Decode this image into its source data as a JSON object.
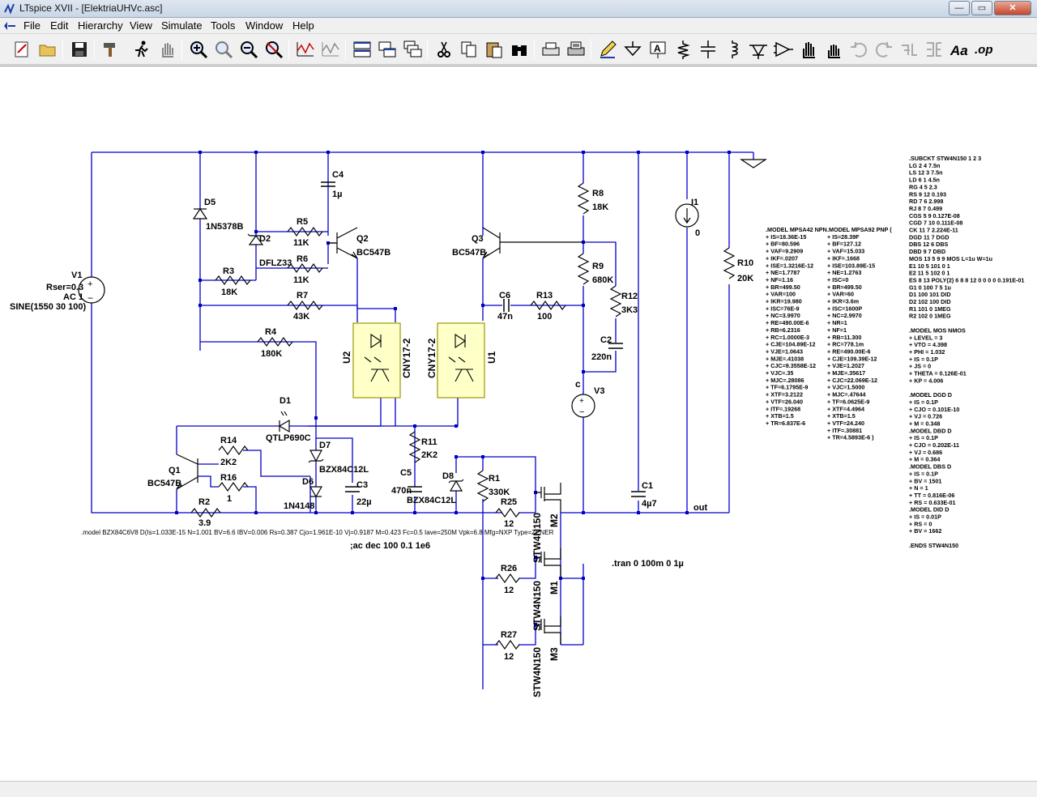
{
  "window": {
    "title": "LTspice XVII - [ElektriaUHVc.asc]",
    "controls": [
      "—",
      "▭",
      "✕"
    ],
    "mdi_controls": [
      "_",
      "❐",
      "✕"
    ]
  },
  "menu": {
    "items": [
      "File",
      "Edit",
      "Hierarchy",
      "View",
      "Simulate",
      "Tools",
      "Window",
      "Help"
    ]
  },
  "toolbar": {
    "buttons": [
      {
        "name": "new-schematic",
        "icon": "new-schematic-icon"
      },
      {
        "name": "open",
        "icon": "folder-open-icon"
      },
      {
        "name": "save",
        "icon": "floppy-icon"
      },
      {
        "name": "control-panel",
        "icon": "hammer-icon"
      },
      {
        "name": "run",
        "icon": "running-man-icon"
      },
      {
        "name": "halt",
        "icon": "hand-icon"
      },
      {
        "name": "zoom-in",
        "icon": "zoom-in-icon"
      },
      {
        "name": "pan",
        "icon": "magnifier-icon"
      },
      {
        "name": "zoom-out",
        "icon": "zoom-out-icon"
      },
      {
        "name": "zoom-fit",
        "icon": "zoom-fit-icon"
      },
      {
        "name": "autorange",
        "icon": "waveform-icon"
      },
      {
        "name": "pick-visible",
        "icon": "waveform-pick-icon"
      },
      {
        "name": "tile-horizontal",
        "icon": "tile-horizontal-icon"
      },
      {
        "name": "tile-vertical",
        "icon": "tile-vertical-icon"
      },
      {
        "name": "cascade",
        "icon": "cascade-icon"
      },
      {
        "name": "cut",
        "icon": "scissors-icon"
      },
      {
        "name": "copy",
        "icon": "copy-icon"
      },
      {
        "name": "paste",
        "icon": "paste-icon"
      },
      {
        "name": "find",
        "icon": "binoculars-icon"
      },
      {
        "name": "print-setup",
        "icon": "print-setup-icon"
      },
      {
        "name": "print",
        "icon": "printer-icon"
      },
      {
        "name": "draw-wire",
        "icon": "pencil-icon"
      },
      {
        "name": "ground",
        "icon": "ground-icon"
      },
      {
        "name": "label-net",
        "icon": "label-net-icon"
      },
      {
        "name": "resistor",
        "icon": "resistor-icon"
      },
      {
        "name": "capacitor",
        "icon": "capacitor-icon"
      },
      {
        "name": "inductor",
        "icon": "inductor-icon"
      },
      {
        "name": "diode",
        "icon": "diode-icon"
      },
      {
        "name": "component",
        "icon": "component-icon"
      },
      {
        "name": "move",
        "icon": "move-hand-icon"
      },
      {
        "name": "drag",
        "icon": "drag-hand-icon"
      },
      {
        "name": "undo",
        "icon": "undo-icon"
      },
      {
        "name": "redo",
        "icon": "redo-icon"
      },
      {
        "name": "rotate",
        "icon": "rotate-icon"
      },
      {
        "name": "mirror",
        "icon": "mirror-icon"
      },
      {
        "name": "text",
        "icon": "text-aa-icon"
      },
      {
        "name": "spice-directive",
        "icon": "spice-directive-icon"
      }
    ]
  },
  "components": {
    "V1": {
      "ref": "V1",
      "params": [
        "Rser=0.3",
        "AC 1",
        "SINE(1550 30 100)"
      ]
    },
    "D5": {
      "ref": "D5",
      "value": "1N5378B"
    },
    "D2": {
      "ref": "D2",
      "value": "DFLZ33"
    },
    "R5": {
      "ref": "R5",
      "value": "11K"
    },
    "R6": {
      "ref": "R6",
      "value": "11K"
    },
    "R3": {
      "ref": "R3",
      "value": "18K"
    },
    "R7": {
      "ref": "R7",
      "value": "43K"
    },
    "R4": {
      "ref": "R4",
      "value": "180K"
    },
    "C4": {
      "ref": "C4",
      "value": "1µ"
    },
    "Q2": {
      "ref": "Q2",
      "value": "BC547B"
    },
    "Q3": {
      "ref": "Q3",
      "value": "BC547B"
    },
    "R8": {
      "ref": "R8",
      "value": "18K"
    },
    "R9": {
      "ref": "R9",
      "value": "680K"
    },
    "R12": {
      "ref": "R12",
      "value": "3K3"
    },
    "C6": {
      "ref": "C6",
      "value": "47n"
    },
    "R13": {
      "ref": "R13",
      "value": "100"
    },
    "C2": {
      "ref": "C2",
      "value": "220n"
    },
    "U2": {
      "ref": "U2",
      "value": "CNY17-2"
    },
    "U1": {
      "ref": "U1",
      "value": "CNY17-2"
    },
    "V3": {
      "ref": "V3",
      "node": "c"
    },
    "I1": {
      "ref": "I1",
      "value": "0"
    },
    "R10": {
      "ref": "R10",
      "value": "20K"
    },
    "C1": {
      "ref": "C1",
      "value": "4µ7"
    },
    "D1": {
      "ref": "D1",
      "value": "QTLP690C"
    },
    "D7": {
      "ref": "D7",
      "value": "BZX84C12L"
    },
    "D6": {
      "ref": "D6",
      "value": "1N4148"
    },
    "C3": {
      "ref": "C3",
      "value": "22µ"
    },
    "R11": {
      "ref": "R11",
      "value": "2K2"
    },
    "C5": {
      "ref": "C5",
      "value": "470n"
    },
    "D8": {
      "ref": "D8",
      "value": "BZX84C12L"
    },
    "R1": {
      "ref": "R1",
      "value": "330K"
    },
    "R14": {
      "ref": "R14",
      "value": "2K2"
    },
    "R16": {
      "ref": "R16",
      "value": "1"
    },
    "Q1": {
      "ref": "Q1",
      "value": "BC547B"
    },
    "R2": {
      "ref": "R2",
      "value": "3.9"
    },
    "R25": {
      "ref": "R25",
      "value": "12"
    },
    "R26": {
      "ref": "R26",
      "value": "12"
    },
    "R27": {
      "ref": "R27",
      "value": "12"
    },
    "M1": {
      "ref": "M1",
      "value": "STW4N150"
    },
    "M2": {
      "ref": "M2",
      "value": "STW4N150"
    },
    "M3": {
      "ref": "M3",
      "value": "STW4N150"
    }
  },
  "net_labels": {
    "out": "out"
  },
  "directives": {
    "zener_model": ".model BZX84C6V8 D(Is=1.033E-15 N=1.001 BV=6.6 IBV=0.006 Rs=0.387 Cjo=1.961E-10 Vj=0.9187 M=0.423 Fc=0.5 Iave=250M Vpk=6.8 Mfg=NXP Type=ZENER",
    "ac": ";ac dec 100 0.1 1e6",
    "tran": ".tran 0 100m 0 1µ",
    "npn_model": [
      ".MODEL MPSA42 NPN",
      "+ IS=18.36E-15",
      "+ BF=80.596",
      "+ VAF=9.2909",
      "+ IKF=.0207",
      "+ ISE=1.3216E-12",
      "+ NE=1.7787",
      "+ NF=1.16",
      "+ BR=499.50",
      "+ VAR=100",
      "+ IKR=19.980",
      "+ ISC=76E-9",
      "+ NC=3.9970",
      "+ RE=490.00E-6",
      "+ RB=6.2316",
      "+ RC=1.0000E-3",
      "+ CJE=104.89E-12",
      "+ VJE=1.0643",
      "+ MJE=.41038",
      "+ CJC=9.3558E-12",
      "+ VJC=.35",
      "+ MJC=.28086",
      "+ TF=6.1795E-9",
      "+ XTF=3.2122",
      "+ VTF=26.040",
      "+ ITF=.19268",
      "+ XTB=1.5",
      "+ TR=6.837E-6"
    ],
    "pnp_model": [
      ".MODEL MPSA92 PNP (",
      "+ IS=28.39F",
      "+ BF=127.12",
      "+ VAF=15.033",
      "+ IKF=.1668",
      "+ ISE=103.89E-15",
      "+ NE=1.2763",
      "+ ISC=0",
      "+ BR=499.50",
      "+ VAR=60",
      "+ IKR=3.6m",
      "+ ISC=1600P",
      "+ NC=2.9970",
      "+ NR=1",
      "+ NF=1",
      "+ RB=11.300",
      "+ RC=778.1m",
      "+ RE=490.00E-6",
      "+ CJE=109.39E-12",
      "+ VJE=1.2027",
      "+ MJE=.35617",
      "+ CJC=22.069E-12",
      "+ VJC=1.5000",
      "+ MJC=.47644",
      "+ TF=6.0625E-9",
      "+ XTF=4.4964",
      "+ XTB=1.5",
      "+ VTF=24.240",
      "+ ITF=.30881",
      "+ TR=4.5893E-6 )"
    ],
    "subckt": [
      ".SUBCKT STW4N150 1 2 3",
      "LG 2 4  7.5n",
      "LS 12 3 7.5n",
      "LD 6 1  4.5n",
      "RG 4 5  2.3",
      "RS 9 12 0.193",
      "RD 7 6  2.998",
      "RJ 8 7  0.499",
      "CGS 5 9   0.127E-08",
      "CGD 7 10  0.111E-08",
      "CK  11 7  2.224E-11",
      "DGD 11 7 DGD",
      "DBS 12 6 DBS",
      "DBD  9 7 DBD",
      "MOS  13 5 9 9 MOS L=1u W=1u",
      "E1  10 5 101 0 1",
      "E2  11 5 102 0 1",
      "ES  8 13 POLY(2) 6 8 8 12 0 0 0 0  0.191E-01",
      "G1  0 100 7 5 1u",
      "D1  100 101  DID",
      "D2  102 100  DID",
      "R1  101 0  1MEG",
      "R2  102 0  1MEG",
      "",
      ".MODEL MOS NMOS",
      "+ LEVEL = 3",
      "+ VTO    = 4.398",
      "+ PHI    = 1.032",
      "+ IS     = 0.1P",
      "+ JS     = 0",
      "+ THETA = 0.126E-01",
      "+ KP     = 4.006",
      "",
      ".MODEL DGD D",
      "+ IS     = 0.1P",
      "+ CJO   = 0.101E-10",
      "+ VJ     = 0.726",
      "+ M      = 0.348",
      ".MODEL DBD D",
      "+ IS     = 0.1P",
      "+ CJO   = 0.202E-11",
      "+ VJ     = 0.686",
      "+ M      = 0.364",
      ".MODEL DBS D",
      "+ IS     = 0.1P",
      "+ BV     = 1501",
      "+ N      = 1",
      "+ TT     = 0.816E-06",
      "+ RS     = 0.633E-01",
      ".MODEL DID D",
      "+ IS     = 0.01P",
      "+ RS     = 0",
      "+ BV     = 1662",
      "",
      ".ENDS STW4N150"
    ]
  },
  "colors": {
    "wire": "#0000cc",
    "component": "#000000",
    "junction": "#0000cc",
    "opto_fill": "#ffffc8",
    "opto_border": "#999900",
    "text": "#000000"
  }
}
